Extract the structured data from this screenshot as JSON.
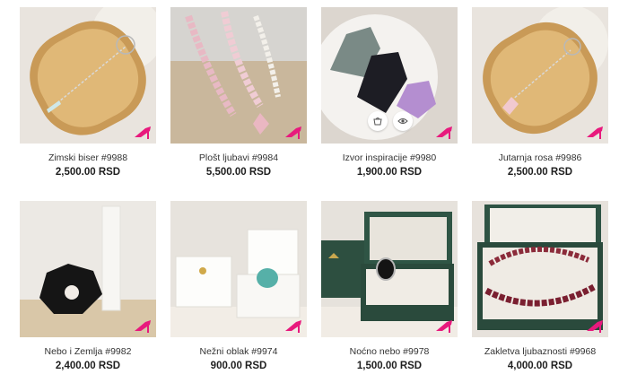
{
  "products": [
    {
      "name": "Zimski biser #9988",
      "price": "2,500.00 RSD",
      "image": "bamboo-tray-crystal-pendant"
    },
    {
      "name": "Plošt ljubavi #9984",
      "price": "5,500.00 RSD",
      "image": "rose-quartz-beaded-necklaces"
    },
    {
      "name": "Izvor inspiracije #9980",
      "price": "1,900.00 RSD",
      "image": "raw-crystals-bowl"
    },
    {
      "name": "Jutarnja rosa #9986",
      "price": "2,500.00 RSD",
      "image": "bamboo-tray-rose-quartz-pendant"
    },
    {
      "name": "Nebo i Zemlja #9982",
      "price": "2,400.00 RSD",
      "image": "black-obsidian-and-selenite-tower"
    },
    {
      "name": "Nežni oblak #9974",
      "price": "900.00 RSD",
      "image": "turquoise-ring-white-box"
    },
    {
      "name": "Noćno nebo #9978",
      "price": "1,500.00 RSD",
      "image": "black-stone-ring-green-box"
    },
    {
      "name": "Zakletva ljubaznosti #9968",
      "price": "4,000.00 RSD",
      "image": "garnet-bracelet-green-box"
    }
  ],
  "icons": {
    "badge": "high-heel-icon",
    "cart": "add-to-cart-icon",
    "quickview": "eye-icon"
  },
  "colors": {
    "badge": "#e8197d",
    "price": "#1f1f1f"
  }
}
